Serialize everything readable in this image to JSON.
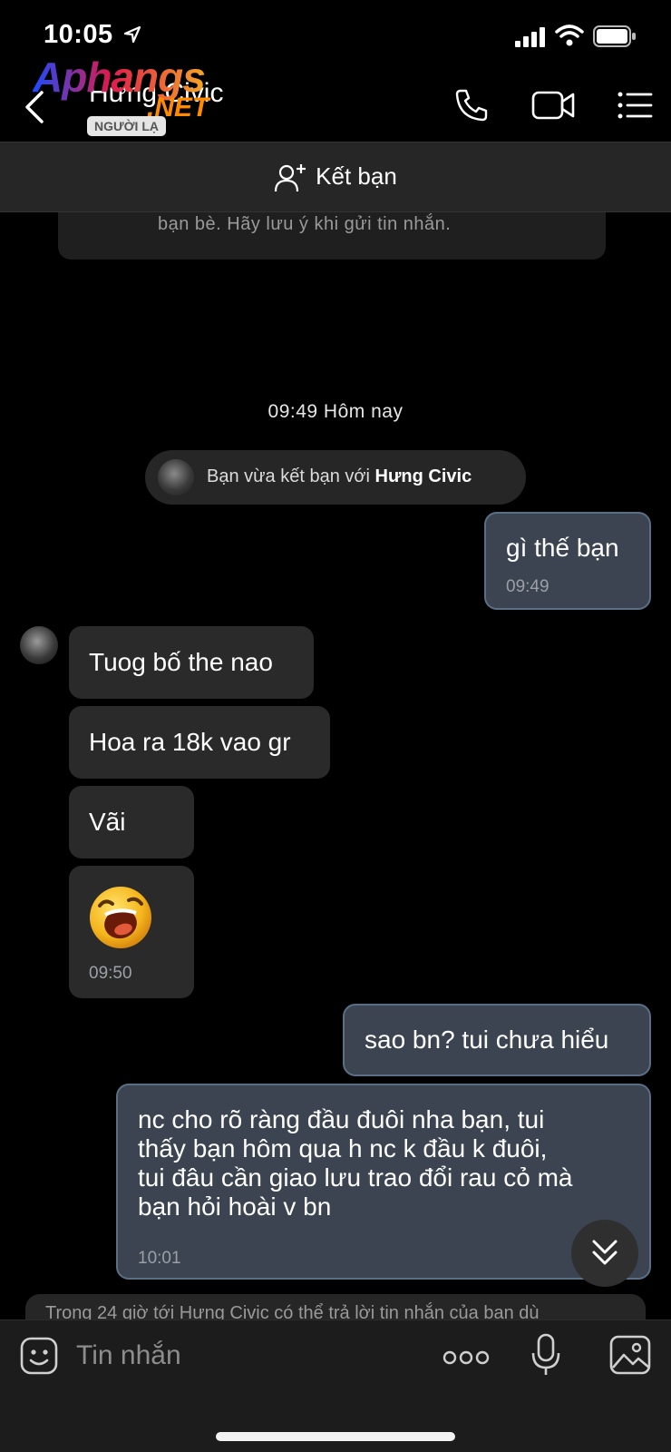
{
  "status_bar": {
    "time": "10:05"
  },
  "header": {
    "contact_name": "Hưng Civic",
    "badge": "NGƯỜI LẠ",
    "watermark": {
      "main": "Aphangs",
      "suffix": ".NET"
    }
  },
  "friend_bar": {
    "label": "Kết bạn"
  },
  "notice_top": {
    "text": "bạn bè. Hãy lưu ý khi gửi tin nhắn."
  },
  "day_stamp": "09:49 Hôm nay",
  "system_message": {
    "prefix": "Bạn vừa kết bạn với ",
    "name": "Hưng Civic"
  },
  "messages": [
    {
      "dir": "out",
      "text": "gì thế bạn",
      "time": "09:49"
    },
    {
      "dir": "in",
      "text": "Tuog bố the nao"
    },
    {
      "dir": "in",
      "text": "Hoa ra 18k vao gr"
    },
    {
      "dir": "in",
      "text": "Vãi"
    },
    {
      "dir": "in",
      "sticker": "laughing-face",
      "time": "09:50"
    },
    {
      "dir": "out",
      "text": "sao bn? tui chưa hiểu"
    },
    {
      "dir": "out",
      "lines": [
        "nc cho rõ ràng đầu đuôi nha bạn, tui",
        "thấy bạn hôm qua h nc k đầu k đuôi,",
        "tui đâu cần giao lưu trao đổi rau cỏ mà",
        "bạn hỏi hoài v bn"
      ],
      "time": "10:01"
    }
  ],
  "notice_bottom": {
    "text": "Trong 24 giờ tới Hưng Civic có thể trả lời tin nhắn của bạn dù"
  },
  "composer": {
    "placeholder": "Tin nhắn"
  },
  "colors": {
    "outgoing_bubble": "#3b4450",
    "outgoing_border": "#5a6f86",
    "incoming_bubble": "#2a2a2a",
    "background": "#000000"
  }
}
